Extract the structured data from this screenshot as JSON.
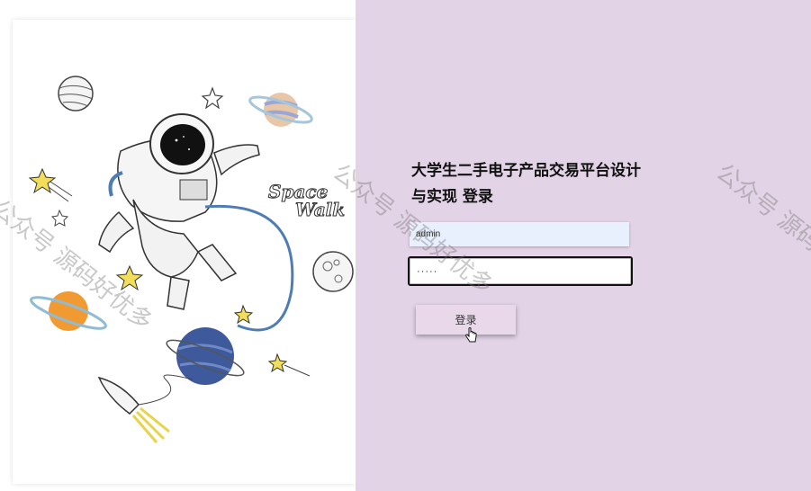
{
  "login": {
    "title": "大学生二手电子产品交易平台设计与实现 登录",
    "username_value": "admin",
    "password_value": "·····",
    "button_label": "登录"
  },
  "illustration": {
    "space_word": "Space",
    "walk_word": "Walk"
  },
  "watermark": {
    "left": "公众号 源码好优多",
    "middle": "公众号 源码好优多",
    "right": "公众号 源码好优多"
  },
  "colors": {
    "background": "#e3d3e7",
    "username_bg": "#e8f0fe",
    "button_bg": "#e8d8ea"
  }
}
